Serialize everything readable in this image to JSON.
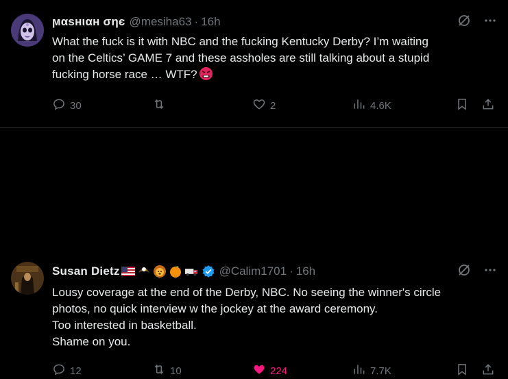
{
  "tweets": [
    {
      "author_name": "ϻαѕнιαн σηє",
      "handle": "@mesiha63",
      "time": "16h",
      "lines": [
        "What the fuck is it with NBC and the fucking Kentucky Derby? I’m waiting",
        "on the Celtics’ GAME 7 and these assholes are still talking about a stupid",
        "fucking horse race … WTF?"
      ],
      "replies": "30",
      "retweets": "",
      "likes": "2",
      "views": "4.6K",
      "liked": false
    },
    {
      "author_name": "Susan Dietz",
      "name_emojis": [
        "us-flag",
        "eagle",
        "lion",
        "orange",
        "truck"
      ],
      "verified": true,
      "handle": "@Calim1701",
      "time": "16h",
      "lines": [
        "Lousy coverage at the end of the Derby, NBC. No seeing the winner's circle",
        "photos, no quick interview w the jockey at the award ceremony.",
        "Too interested in basketball.",
        "Shame on you."
      ],
      "replies": "12",
      "retweets": "10",
      "likes": "224",
      "views": "7.7K",
      "liked": true
    }
  ],
  "colors": {
    "background": "#000000",
    "text": "#e7e9ea",
    "muted": "#71767b",
    "like": "#f91880",
    "verified": "#1d9bf0",
    "divider": "#2f3336"
  },
  "dot": "·"
}
